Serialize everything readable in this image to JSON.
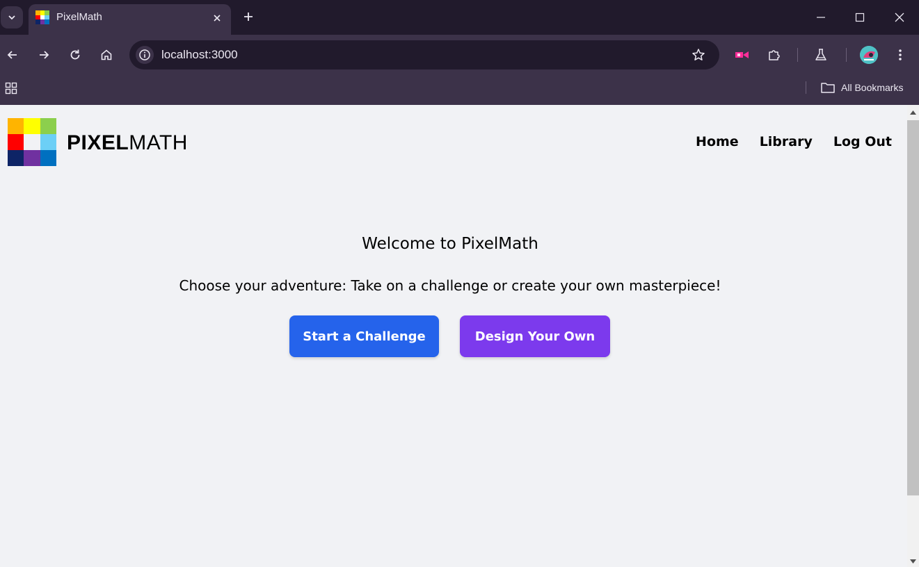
{
  "browser": {
    "tab": {
      "title": "PixelMath"
    },
    "address_bar": {
      "url": "localhost:3000"
    },
    "bookmarks": {
      "all_bookmarks_label": "All Bookmarks"
    }
  },
  "site": {
    "brand": {
      "bold": "PIXEL",
      "light": "MATH"
    },
    "logo_colors": [
      "#ffb400",
      "#ffff00",
      "#8ccf4d",
      "#ff0000",
      "#f1f2f5",
      "#6ccff6",
      "#0e2466",
      "#7031a0",
      "#0070c0"
    ],
    "nav": {
      "home": "Home",
      "library": "Library",
      "logout": "Log Out"
    }
  },
  "hero": {
    "title": "Welcome to PixelMath",
    "subtitle": "Choose your adventure: Take on a challenge or create your own masterpiece!",
    "primary_cta": "Start a Challenge",
    "secondary_cta": "Design Your Own"
  },
  "colors": {
    "primary_button": "#2563eb",
    "secondary_button": "#7c3aed",
    "page_background": "#f1f2f5",
    "chrome_background": "#3c3249"
  }
}
